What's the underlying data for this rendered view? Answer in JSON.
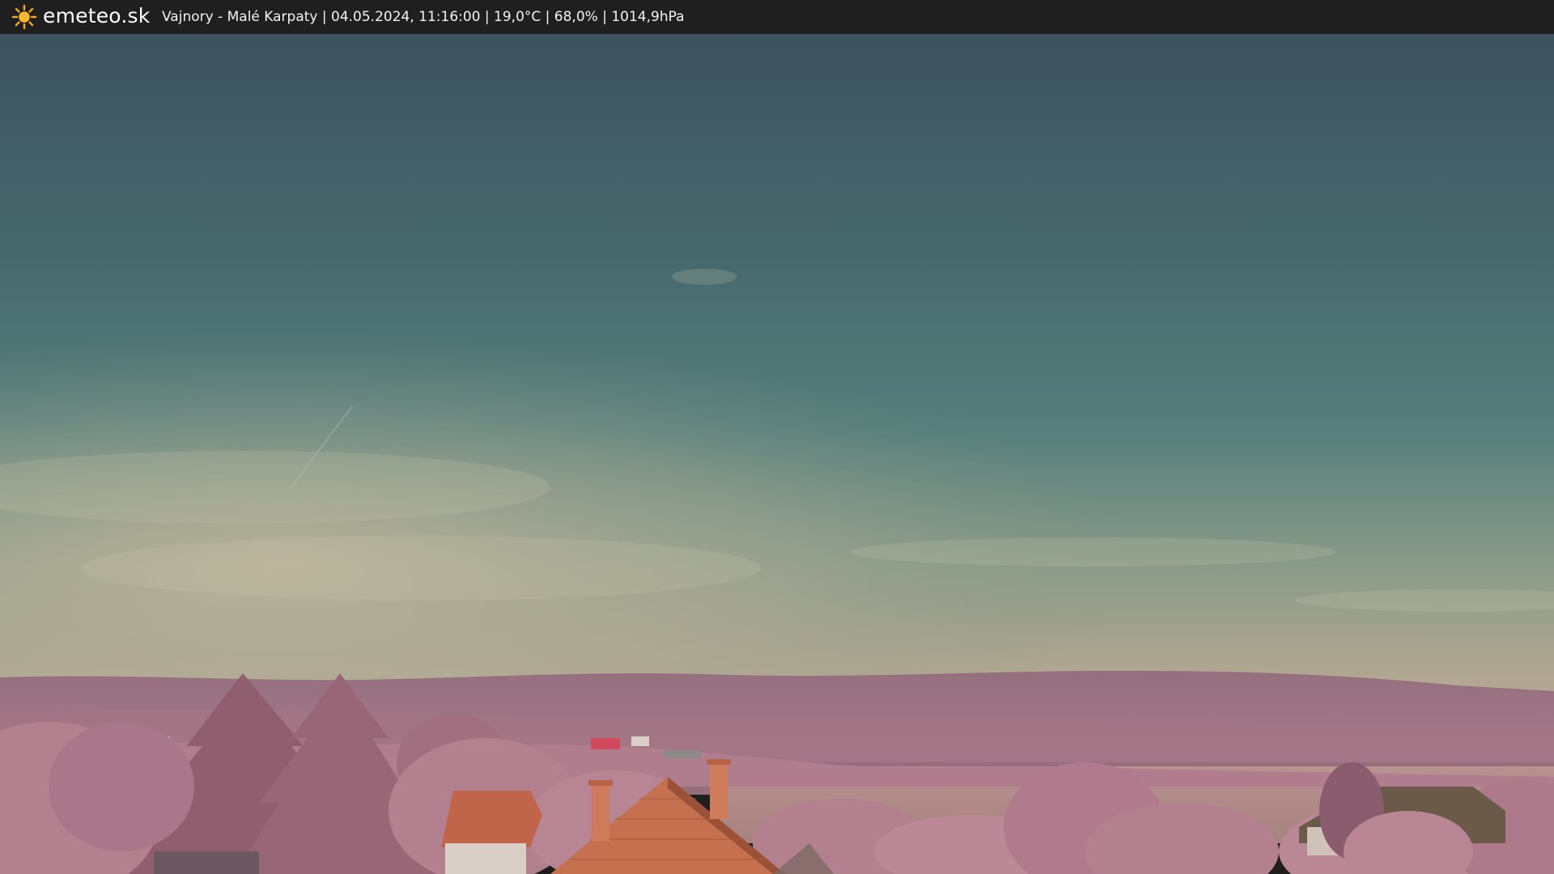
{
  "header": {
    "brand": "emeteo.sk",
    "logo_icon": "sun-icon",
    "caption": "Vajnory - Malé Karpaty | 04.05.2024, 11:16:00 | 19,0°C | 68,0% | 1014,9hPa"
  },
  "colors": {
    "bar_background": "#1f1f1f",
    "bar_text": "#f2f2f2",
    "sun": "#f5a623",
    "sky_top": "#3f5560",
    "sky_mid": "#4f7774",
    "sky_horizon": "#a7a288",
    "hills": "#9a6f80",
    "foliage": "#b57f90",
    "field": "#b28c89",
    "roof": "#c0654a"
  }
}
